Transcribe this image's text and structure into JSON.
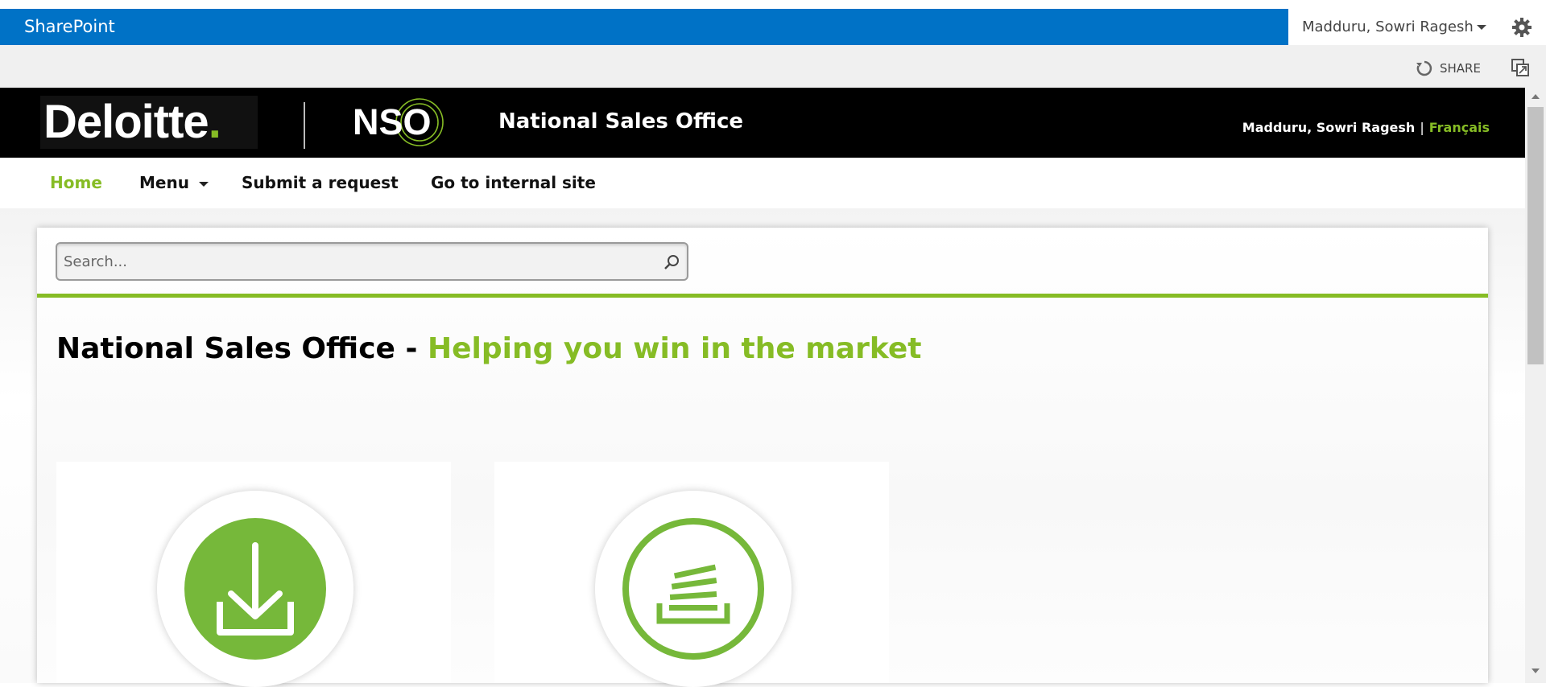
{
  "suitebar": {
    "brand": "SharePoint",
    "user_name": "Madduru, Sowri Ragesh",
    "settings_icon": "gear-icon",
    "bg_color": "#0072c6"
  },
  "ribbon": {
    "share_label": "SHARE",
    "share_icon": "sync-share-icon",
    "focus_icon": "focus-content-icon"
  },
  "header": {
    "logo_text": "Deloitte",
    "logo_dot": ".",
    "nso_text": "NSO",
    "site_title": "National Sales Office",
    "user_name": "Madduru, Sowri Ragesh",
    "separator": "|",
    "language_link": "Français",
    "accent_color": "#86bc25"
  },
  "nav": {
    "items": [
      {
        "label": "Home"
      },
      {
        "label": "Menu"
      },
      {
        "label": "Submit a request"
      },
      {
        "label": "Go to internal site"
      }
    ]
  },
  "search": {
    "placeholder": "Search...",
    "value": ""
  },
  "main": {
    "heading_prefix": "National Sales Office - ",
    "heading_accent": "Helping you win in the market"
  },
  "tiles": [
    {
      "icon": "download-icon"
    },
    {
      "icon": "document-stack-icon"
    }
  ]
}
